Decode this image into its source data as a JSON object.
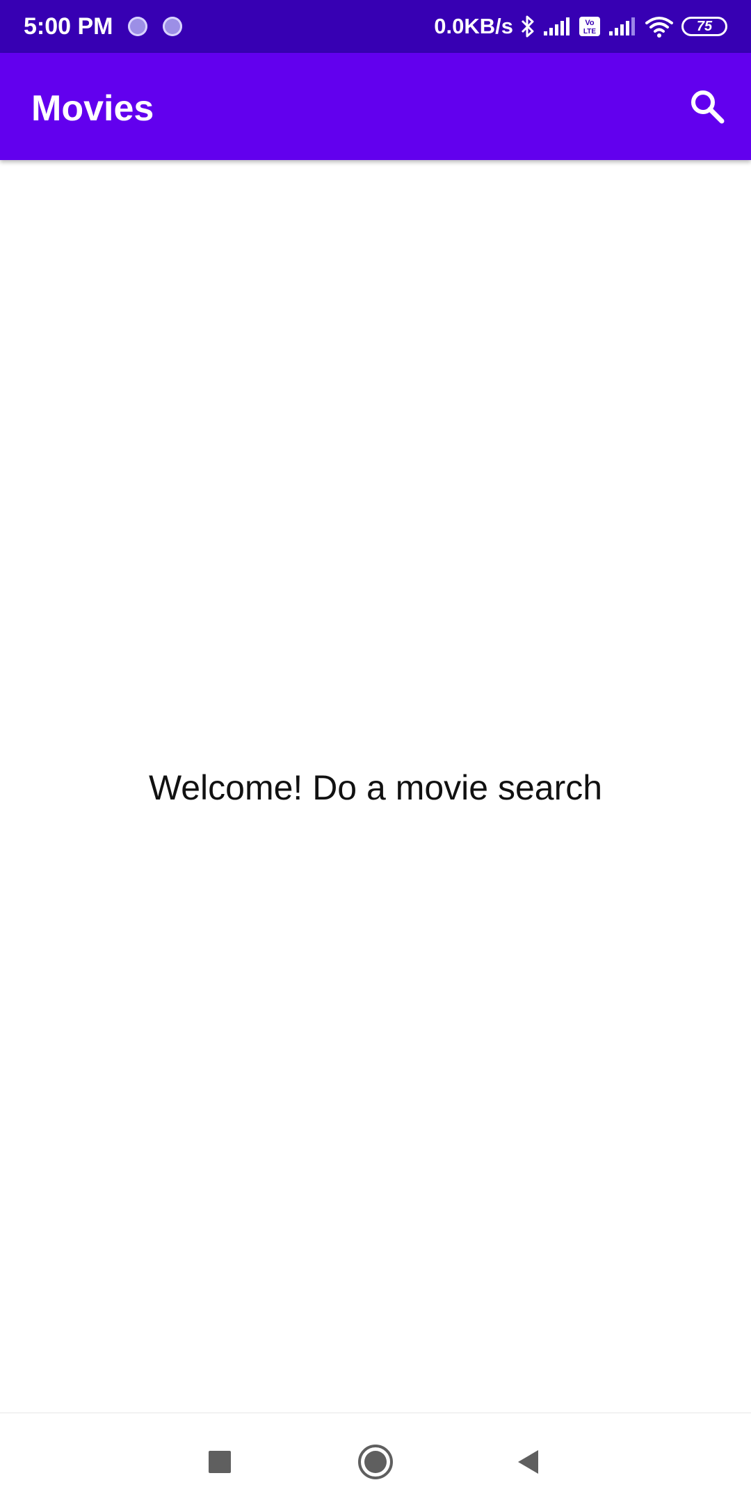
{
  "status_bar": {
    "time": "5:00 PM",
    "net_speed": "0.0KB/s",
    "battery_level": "75",
    "icons": [
      "notification-dot-icon",
      "notification-dot-icon",
      "bluetooth-icon",
      "signal-icon",
      "volte-icon",
      "signal-icon",
      "wifi-icon",
      "battery-icon"
    ]
  },
  "app_bar": {
    "title": "Movies",
    "search_icon": "search-icon"
  },
  "main": {
    "welcome_text": "Welcome! Do a movie search"
  },
  "nav_bar": {
    "icons": [
      "recents-square-icon",
      "home-circle-icon",
      "back-triangle-icon"
    ]
  },
  "colors": {
    "status_bar": "#3700b3",
    "app_bar": "#6200ee",
    "background": "#ffffff"
  }
}
